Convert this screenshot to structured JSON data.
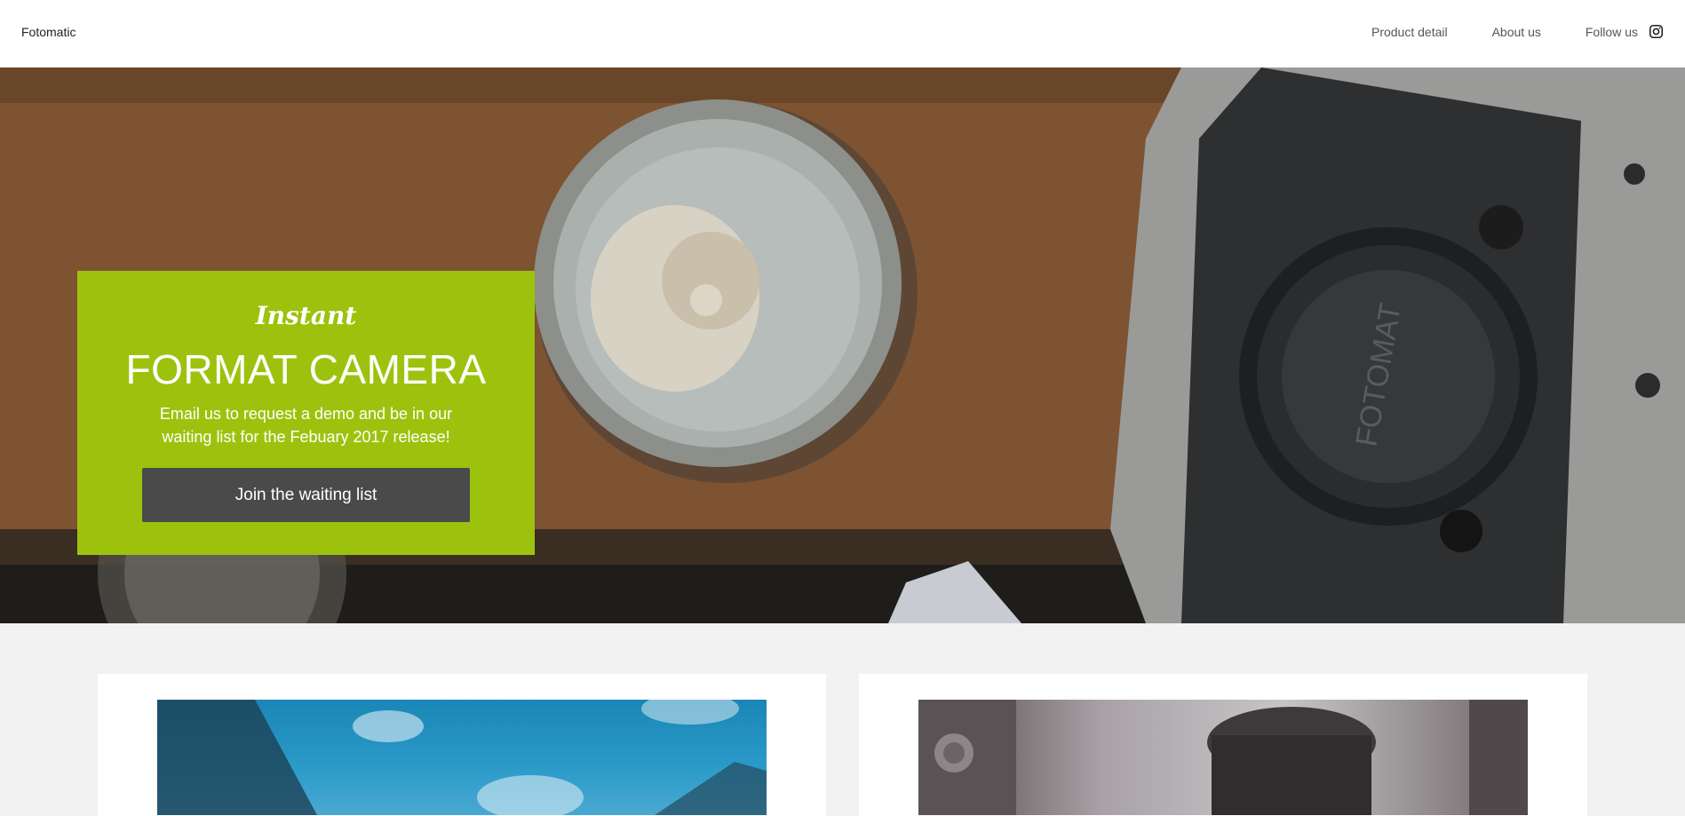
{
  "header": {
    "brand": "Fotomatic",
    "nav": [
      {
        "label": "Product detail"
      },
      {
        "label": "About us"
      },
      {
        "label": "Follow us",
        "icon": "instagram-icon"
      }
    ]
  },
  "hero": {
    "image": "camera-and-bowl-photo",
    "promo": {
      "script_title": "Instant",
      "title": "FORMAT CAMERA",
      "description": "Email us to request a demo and be in our waiting list for the Febuary 2017 release!",
      "cta_label": "Join the waiting list",
      "background_color": "#9dc20d",
      "button_color": "#4a4a4a"
    }
  },
  "cards": [
    {
      "image": "blue-sky-mountain-photo"
    },
    {
      "image": "camera-closeup-photo"
    }
  ]
}
